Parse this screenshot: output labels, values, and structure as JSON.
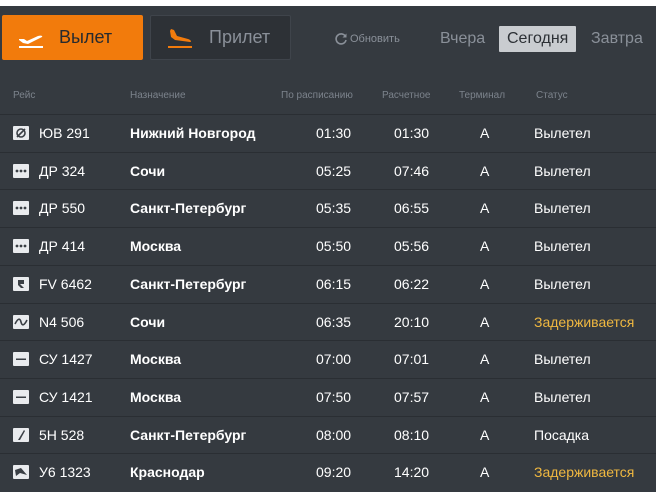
{
  "header": {
    "departures_label": "Вылет",
    "arrivals_label": "Прилет",
    "refresh_label": "Обновить",
    "days": {
      "yesterday": "Вчера",
      "today": "Сегодня",
      "tomorrow": "Завтра"
    }
  },
  "columns": {
    "flight": "Рейс",
    "destination": "Назначение",
    "scheduled": "По расписанию",
    "estimated": "Расчетное",
    "terminal": "Терминал",
    "status": "Статус"
  },
  "flights": [
    {
      "airline_icon": "utair-logo-icon",
      "flight": "ЮВ 291",
      "destination": "Нижний Новгород",
      "scheduled": "01:30",
      "estimated": "01:30",
      "terminal": "A",
      "status": "Вылетел",
      "delayed": false
    },
    {
      "airline_icon": "airline-dots-icon",
      "flight": "ДР 324",
      "destination": "Сочи",
      "scheduled": "05:25",
      "estimated": "07:46",
      "terminal": "A",
      "status": "Вылетел",
      "delayed": false
    },
    {
      "airline_icon": "airline-dots-icon",
      "flight": "ДР 550",
      "destination": "Санкт-Петербург",
      "scheduled": "05:35",
      "estimated": "06:55",
      "terminal": "A",
      "status": "Вылетел",
      "delayed": false
    },
    {
      "airline_icon": "airline-dots-icon",
      "flight": "ДР 414",
      "destination": "Москва",
      "scheduled": "05:50",
      "estimated": "05:56",
      "terminal": "A",
      "status": "Вылетел",
      "delayed": false
    },
    {
      "airline_icon": "airline-r-icon",
      "flight": "FV 6462",
      "destination": "Санкт-Петербург",
      "scheduled": "06:15",
      "estimated": "06:22",
      "terminal": "A",
      "status": "Вылетел",
      "delayed": false
    },
    {
      "airline_icon": "airline-wave-icon",
      "flight": "N4 506",
      "destination": "Сочи",
      "scheduled": "06:35",
      "estimated": "20:10",
      "terminal": "A",
      "status": "Задерживается",
      "delayed": true
    },
    {
      "airline_icon": "airline-dash-icon",
      "flight": "СУ 1427",
      "destination": "Москва",
      "scheduled": "07:00",
      "estimated": "07:01",
      "terminal": "A",
      "status": "Вылетел",
      "delayed": false
    },
    {
      "airline_icon": "airline-dash-icon",
      "flight": "СУ 1421",
      "destination": "Москва",
      "scheduled": "07:50",
      "estimated": "07:57",
      "terminal": "A",
      "status": "Вылетел",
      "delayed": false
    },
    {
      "airline_icon": "airline-slash-icon",
      "flight": "5Н 528",
      "destination": "Санкт-Петербург",
      "scheduled": "08:00",
      "estimated": "08:10",
      "terminal": "A",
      "status": "Посадка",
      "delayed": false
    },
    {
      "airline_icon": "airline-plane-icon",
      "flight": "У6 1323",
      "destination": "Краснодар",
      "scheduled": "09:20",
      "estimated": "14:20",
      "terminal": "A",
      "status": "Задерживается",
      "delayed": true
    }
  ],
  "colors": {
    "background": "#353a40",
    "accent": "#f27b0c",
    "delayed_status": "#f0b840",
    "today_highlight": "#c9ccd0"
  }
}
